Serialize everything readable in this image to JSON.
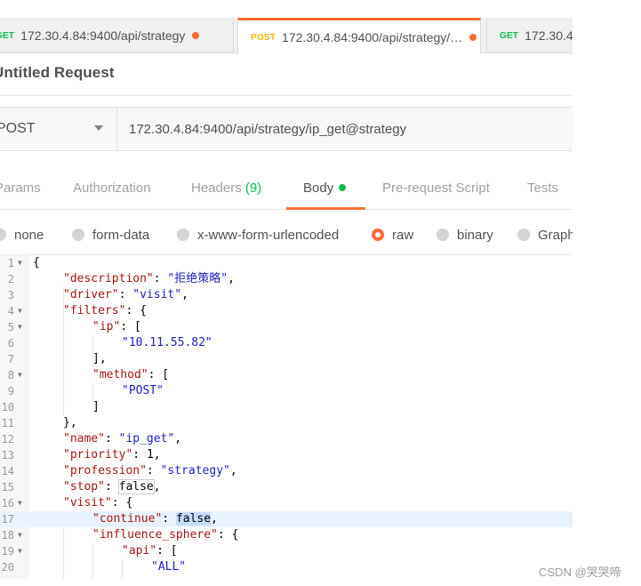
{
  "tabs": [
    {
      "method": "GET",
      "label": "172.30.4.84:9400/api/strategy"
    },
    {
      "method": "POST",
      "label": "172.30.4.84:9400/api/strategy/…"
    },
    {
      "method": "GET",
      "label": "172.30.4"
    }
  ],
  "request": {
    "title": "Untitled Request",
    "method": "POST",
    "url": "172.30.4.84:9400/api/strategy/ip_get@strategy"
  },
  "subtabs": {
    "params": "Params",
    "authorization": "Authorization",
    "headers": "Headers",
    "headers_count": "(9)",
    "body": "Body",
    "prerequest": "Pre-request Script",
    "tests": "Tests"
  },
  "body_types": {
    "none": "none",
    "form_data": "form-data",
    "urlencoded": "x-www-form-urlencoded",
    "raw": "raw",
    "binary": "binary",
    "graphql": "GraphQL",
    "selected": "raw"
  },
  "editor": {
    "line_numbers": [
      "1",
      "2",
      "3",
      "4",
      "5",
      "6",
      "7",
      "8",
      "9",
      "10",
      "11",
      "12",
      "13",
      "14",
      "15",
      "16",
      "17",
      "18",
      "19",
      "20"
    ],
    "highlighted_line": "17",
    "lines": {
      "l2_key": "\"description\"",
      "l2_val": "\"拒绝策略\"",
      "l3_key": "\"driver\"",
      "l3_val": "\"visit\"",
      "l4_key": "\"filters\"",
      "l5_key": "\"ip\"",
      "l6_val": "\"10.11.55.82\"",
      "l8_key": "\"method\"",
      "l9_val": "\"POST\"",
      "l12_key": "\"name\"",
      "l12_val": "\"ip_get\"",
      "l13_key": "\"priority\"",
      "l13_val": "1",
      "l14_key": "\"profession\"",
      "l14_val": "\"strategy\"",
      "l15_key": "\"stop\"",
      "l15_val": "false",
      "l16_key": "\"visit\"",
      "l17_key": "\"continue\"",
      "l17_val": "false",
      "l18_key": "\"influence_sphere\"",
      "l19_key": "\"api\"",
      "l20_val": "\"ALL\""
    }
  },
  "watermark": "CSDN @哭哭啼"
}
